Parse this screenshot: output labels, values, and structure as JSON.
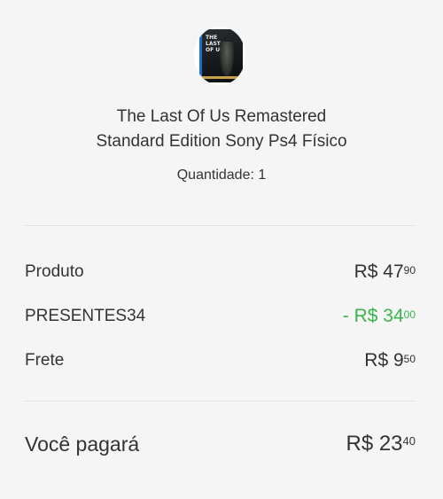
{
  "product": {
    "image_icon": "game-cover-thumbnail",
    "cover_text": "THE\nLAST\nOF US",
    "name_line1": "The Last Of Us Remastered",
    "name_line2": "Standard Edition Sony Ps4 Físico",
    "quantity": "Quantidade: 1"
  },
  "summary": {
    "rows": [
      {
        "label": "Produto",
        "price_main": "R$ 47",
        "price_cents": "90"
      },
      {
        "label": "PRESENTES34",
        "price_main": "- R$ 34",
        "price_cents": "00",
        "color": "#39b54a"
      },
      {
        "label": "Frete",
        "price_main": "R$ 9",
        "price_cents": "50"
      }
    ],
    "total": {
      "label": "Você pagará",
      "price_main": "R$ 23",
      "price_cents": "40"
    }
  },
  "colors": {
    "background": "#f5f5f5",
    "text": "#333333",
    "discount": "#39b54a",
    "divider": "#e2e2e2"
  }
}
